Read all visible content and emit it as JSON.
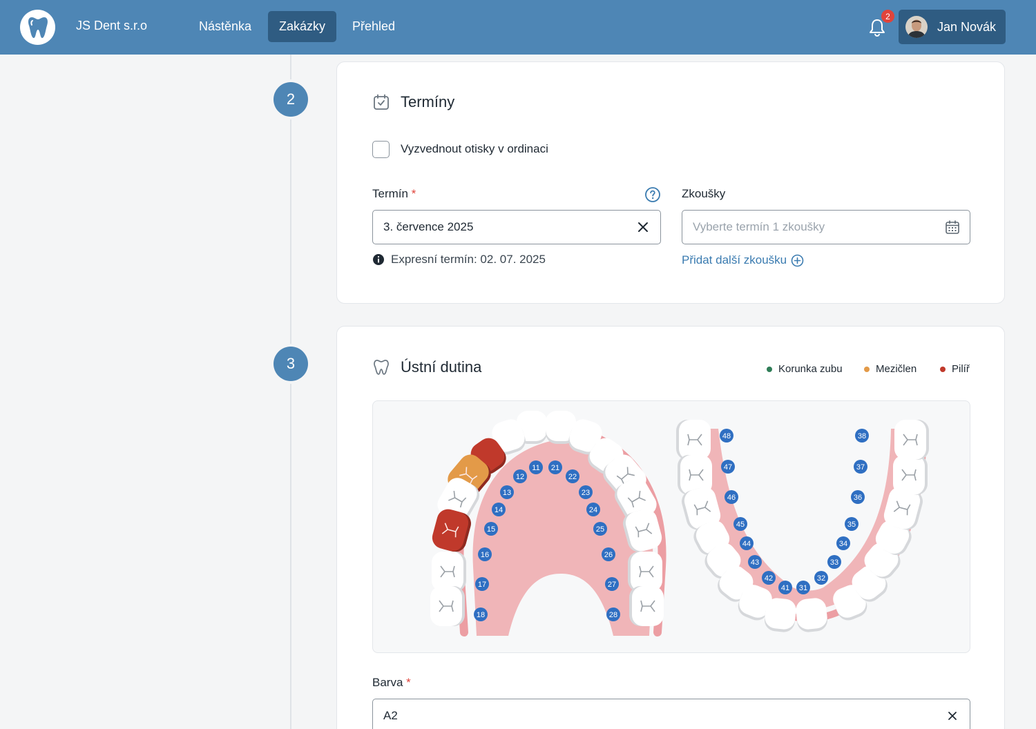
{
  "header": {
    "brand": "JS Dent s.r.o",
    "nav": [
      {
        "label": "Nástěnka",
        "active": false
      },
      {
        "label": "Zakázky",
        "active": true
      },
      {
        "label": "Přehled",
        "active": false
      }
    ],
    "notifications_count": "2",
    "user_name": "Jan Novák",
    "colors": {
      "bar": "#4e86b5",
      "active": "#2f5c82",
      "badge": "#e0443b"
    }
  },
  "steps": [
    "2",
    "3"
  ],
  "terminy": {
    "title": "Termíny",
    "checkbox_label": "Vyzvednout otisky v ordinaci",
    "termin_label": "Termín",
    "required_mark": "*",
    "termin_value": "3. července 2025",
    "express_info": "Expresní termín: 02. 07. 2025",
    "zkousky_label": "Zkoušky",
    "zkousky_placeholder": "Vyberte termín 1 zkoušky",
    "add_link": "Přidat další zkoušku"
  },
  "ustni": {
    "title": "Ústní dutina",
    "legend": [
      {
        "label": "Korunka zubu",
        "color": "#2f7d57"
      },
      {
        "label": "Mezičlen",
        "color": "#e39a48"
      },
      {
        "label": "Pilíř",
        "color": "#c0392b"
      }
    ],
    "upper_teeth": [
      "11",
      "12",
      "13",
      "14",
      "15",
      "16",
      "17",
      "18",
      "21",
      "22",
      "23",
      "24",
      "25",
      "26",
      "27",
      "28"
    ],
    "lower_teeth": [
      "48",
      "47",
      "46",
      "45",
      "44",
      "43",
      "42",
      "41",
      "31",
      "32",
      "33",
      "34",
      "35",
      "36",
      "37",
      "38"
    ],
    "selected": {
      "pilir": [
        "13",
        "16"
      ],
      "mezicen": [
        "14"
      ]
    },
    "barva_label": "Barva",
    "barva_value": "A2"
  }
}
